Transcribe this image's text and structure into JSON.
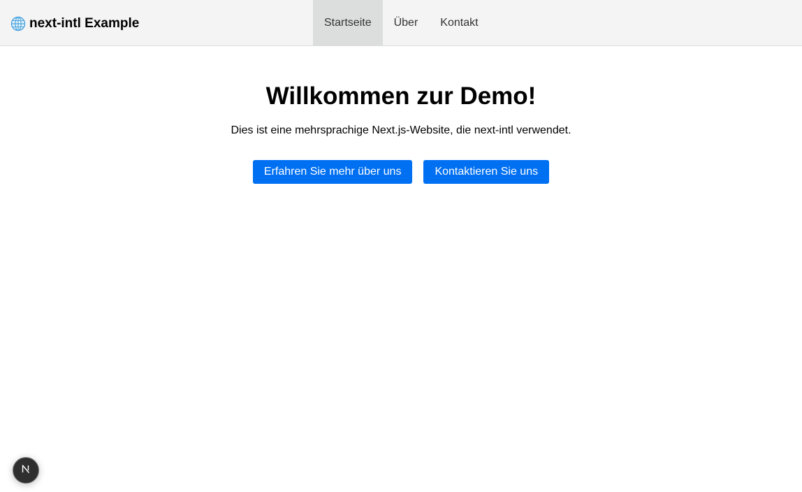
{
  "header": {
    "brand_icon": "globe-icon",
    "brand_title": "next-intl Example",
    "nav": [
      {
        "label": "Startseite",
        "active": true
      },
      {
        "label": "Über",
        "active": false
      },
      {
        "label": "Kontakt",
        "active": false
      }
    ]
  },
  "main": {
    "heading": "Willkommen zur Demo!",
    "subtitle": "Dies ist eine mehrsprachige Next.js-Website, die next-intl verwendet.",
    "buttons": {
      "about_label": "Erfahren Sie mehr über uns",
      "contact_label": "Kontaktieren Sie uns"
    }
  },
  "dev_badge": {
    "icon": "nextjs-logo-icon"
  },
  "colors": {
    "accent": "#0070f3",
    "nav_bg": "#f4f4f4",
    "nav_active_bg": "#dcdedd"
  }
}
